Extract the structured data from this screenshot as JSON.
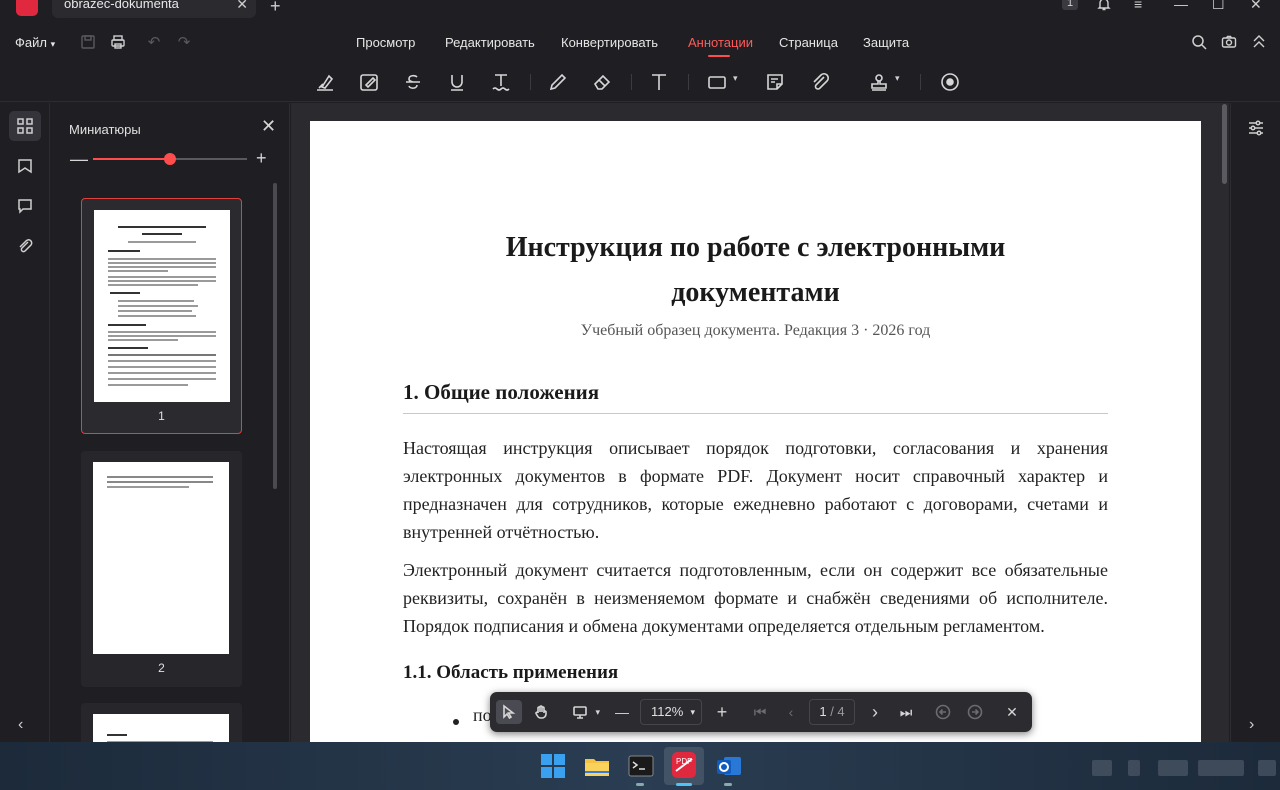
{
  "window": {
    "tab_title": "obrazec-dokumenta",
    "page_badge": "1"
  },
  "menu": {
    "file_label": "Файл",
    "tabs": [
      "Просмотр",
      "Редактировать",
      "Конвертировать",
      "Аннотации",
      "Страница",
      "Защита"
    ],
    "active_tab": "Аннотации"
  },
  "thumbnails": {
    "title": "Миниатюры",
    "zoom_level": 0.5,
    "pages": [
      {
        "number": "1",
        "selected": true
      },
      {
        "number": "2",
        "selected": false
      }
    ]
  },
  "document": {
    "title_line1": "Инструкция по работе с электронными",
    "title_line2": "документами",
    "subtitle": "Учебный образец документа. Редакция 3 · 2026 год",
    "section1": "1. Общие положения",
    "para1": "Настоящая инструкция описывает порядок подготовки, согласования и хранения электронных документов в формате PDF. Документ носит справочный характер и предназначен для сотрудников, которые ежедневно работают с договорами, счетами и внутренней отчётностью.",
    "para2": "Электронный документ считается подготовленным, если он содержит все обязательные реквизиты, сохранён в неизменяемом формате и снабжён сведениями об исполнителе. Порядок подписания и обмена документами определяется отдельным регламентом.",
    "section1_1": "1.1. Область применения",
    "bullet1": "по"
  },
  "floating_toolbar": {
    "zoom": "112%",
    "current_page": "1",
    "total_pages": "/ 4"
  },
  "colors": {
    "accent": "#ff4d4d",
    "background": "#1f1f23",
    "doc_bg": "#2b2b2f"
  }
}
